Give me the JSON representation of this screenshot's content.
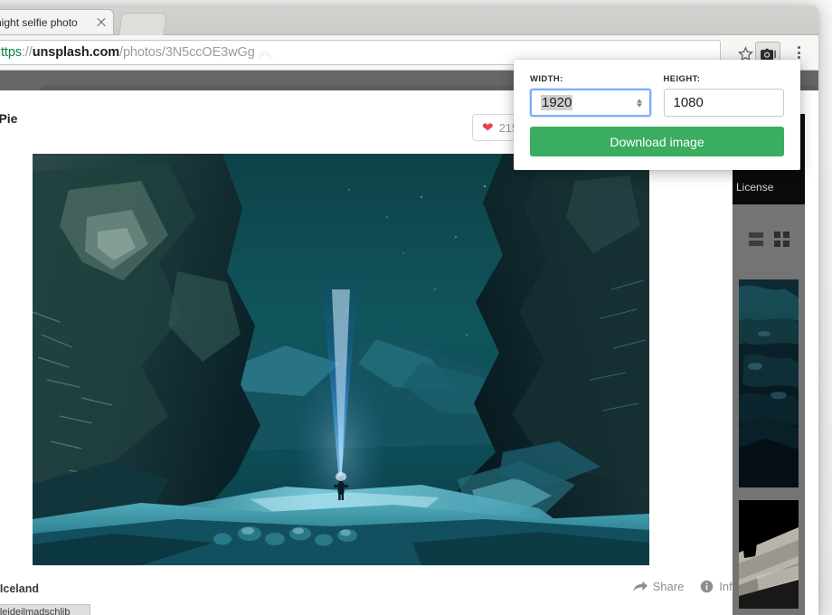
{
  "browser": {
    "tab": {
      "title": "night selfie photo",
      "close_icon": "close-icon"
    },
    "url": {
      "scheme": "https",
      "separator": "://",
      "host": "unsplash.com",
      "path": "/photos/3N5ccOE3wGg"
    },
    "toolbar": {
      "star_icon": "star-icon",
      "extension_icon": "camera-icon",
      "menu_icon": "three-dot-menu-icon"
    },
    "status_bar": {
      "text": "ibmeleideilmadschlib"
    }
  },
  "page": {
    "byline": "n Pie",
    "like": {
      "heart_icon": "heart-icon",
      "count": "215"
    },
    "location": "á, Iceland",
    "actions": [
      {
        "label": "Share",
        "icon": "share-arrow-icon"
      },
      {
        "label": "Info",
        "icon": "info-circle-icon"
      }
    ],
    "rail": {
      "license_label": "License",
      "view_list_icon": "list-view-icon",
      "view_grid_icon": "grid-view-icon"
    }
  },
  "popup": {
    "width_label": "WIDTH:",
    "height_label": "HEIGHT:",
    "width_value": "1920",
    "height_value": "1080",
    "download_label": "Download image",
    "accent_color": "#3aad60",
    "focus_color": "#7aaefc"
  }
}
